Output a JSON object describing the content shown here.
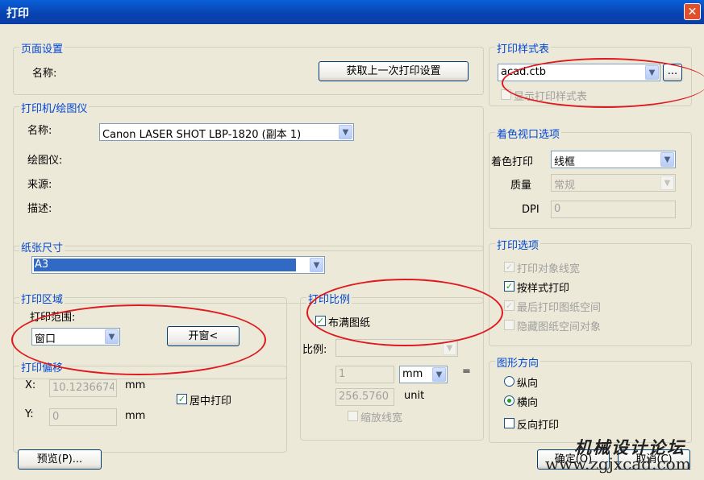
{
  "window": {
    "title": "打印",
    "close": "✕"
  },
  "page_setup": {
    "legend": "页面设置",
    "name_label": "名称:",
    "fetch_button": "获取上一次打印设置"
  },
  "printer": {
    "legend": "打印机/绘图仪",
    "name_label": "名称:",
    "name_value": "Canon LASER SHOT LBP-1820 (副本 1)",
    "plotter_label": "绘图仪:",
    "source_label": "来源:",
    "desc_label": "描述:"
  },
  "paper": {
    "legend": "纸张尺寸",
    "value": "A3"
  },
  "area": {
    "legend": "打印区域",
    "range_label": "打印范围:",
    "range_value": "窗口",
    "window_button": "开窗<"
  },
  "offset": {
    "legend": "打印偏移",
    "x_label": "X:",
    "x_value": "10.1236674",
    "x_unit": "mm",
    "y_label": "Y:",
    "y_value": "0",
    "y_unit": "mm",
    "center_label": "居中打印",
    "center_checked": true
  },
  "scale": {
    "legend": "打印比例",
    "fit_label": "布满图纸",
    "fit_checked": true,
    "ratio_label": "比例:",
    "ratio_value": "",
    "num_value": "1",
    "unit_value": "mm",
    "equals": "=",
    "den_value": "256.5760",
    "unit_label": "unit",
    "scale_lw_label": "缩放线宽"
  },
  "plot_style": {
    "legend": "打印样式表",
    "value": "acad.ctb",
    "browse": "...",
    "show_label": "显示打印样式表"
  },
  "shaded": {
    "legend": "着色视口选项",
    "shade_label": "着色打印",
    "shade_value": "线框",
    "quality_label": "质量",
    "quality_value": "常规",
    "dpi_label": "DPI",
    "dpi_value": "0"
  },
  "options": {
    "legend": "打印选项",
    "items": [
      {
        "label": "打印对象线宽",
        "checked": true,
        "enabled": false
      },
      {
        "label": "按样式打印",
        "checked": true,
        "enabled": true
      },
      {
        "label": "最后打印图纸空间",
        "checked": true,
        "enabled": false
      },
      {
        "label": "隐藏图纸空间对象",
        "checked": false,
        "enabled": false
      }
    ]
  },
  "orientation": {
    "legend": "图形方向",
    "portrait": "纵向",
    "landscape": "横向",
    "reverse": "反向打印",
    "selected": "landscape"
  },
  "footer": {
    "preview": "预览(P)...",
    "ok": "确定(O)",
    "cancel": "取消(C)"
  },
  "watermark": {
    "line1": "机械设计论坛",
    "line2": "www.zgjxcad.com"
  },
  "colors": {
    "title_bar": "#0a5fd8",
    "legend_text": "#0046d5",
    "annotation": "#e0191e",
    "selection": "#316ac5"
  }
}
